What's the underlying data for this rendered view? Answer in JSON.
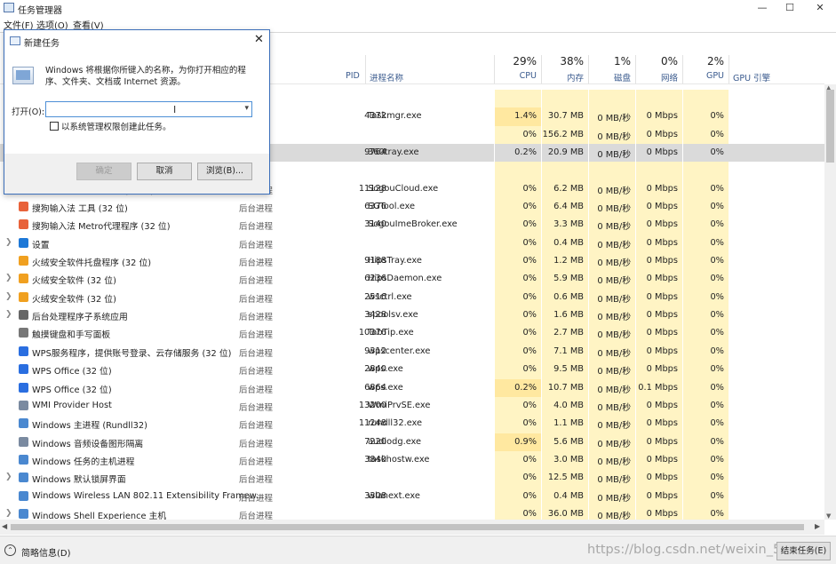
{
  "window": {
    "title": "任务管理器",
    "minimize": "—",
    "maximize": "☐",
    "close": "✕"
  },
  "menu": [
    "文件(F)",
    "选项(O)",
    "查看(V)"
  ],
  "columns": {
    "pid": "PID",
    "process_name": "进程名称",
    "cpu": {
      "pct": "29%",
      "label": "CPU"
    },
    "memory": {
      "pct": "38%",
      "label": "内存"
    },
    "disk": {
      "pct": "1%",
      "label": "磁盘"
    },
    "network": {
      "pct": "0%",
      "label": "网络"
    },
    "gpu": {
      "pct": "2%",
      "label": "GPU"
    },
    "gpu_engine": "GPU 引擎"
  },
  "rows": [
    {
      "name": "",
      "status": "",
      "pid": "",
      "proc": "",
      "cpu": "",
      "mem": "",
      "disk": "",
      "net": "",
      "gpu": ""
    },
    {
      "name": "",
      "status": "",
      "pid": "4372",
      "proc": "Taskmgr.exe",
      "cpu": "1.4%",
      "mem": "30.7 MB",
      "disk": "0 MB/秒",
      "net": "0 Mbps",
      "gpu": "0%"
    },
    {
      "name": "",
      "status": "",
      "pid": "",
      "proc": "",
      "cpu": "0%",
      "mem": "156.2 MB",
      "disk": "0 MB/秒",
      "net": "0 Mbps",
      "gpu": "0%"
    },
    {
      "name": "",
      "status": "",
      "pid": "9764",
      "proc": "360tray.exe",
      "cpu": "0.2%",
      "mem": "20.9 MB",
      "disk": "0 MB/秒",
      "net": "0 Mbps",
      "gpu": "0%",
      "selected": true
    },
    {
      "name": "",
      "status": "",
      "pid": "",
      "proc": "",
      "cpu": "",
      "mem": "",
      "disk": "",
      "net": "",
      "gpu": ""
    },
    {
      "name": "搜狗输入法 云计算代理 (32 位)",
      "status": "后台进程",
      "pid": "11128",
      "proc": "SogouCloud.exe",
      "cpu": "0%",
      "mem": "6.2 MB",
      "disk": "0 MB/秒",
      "net": "0 Mbps",
      "gpu": "0%",
      "icon": "sogou-icon"
    },
    {
      "name": "搜狗输入法 工具 (32 位)",
      "status": "后台进程",
      "pid": "6376",
      "proc": "SGTool.exe",
      "cpu": "0%",
      "mem": "6.4 MB",
      "disk": "0 MB/秒",
      "net": "0 Mbps",
      "gpu": "0%",
      "icon": "sogou-icon"
    },
    {
      "name": "搜狗输入法 Metro代理程序 (32 位)",
      "status": "后台进程",
      "pid": "3140",
      "proc": "SogouImeBroker.exe",
      "cpu": "0%",
      "mem": "3.3 MB",
      "disk": "0 MB/秒",
      "net": "0 Mbps",
      "gpu": "0%",
      "icon": "sogou-icon"
    },
    {
      "name": "设置",
      "status": "后台进程",
      "pid": "",
      "proc": "",
      "cpu": "0%",
      "mem": "0.4 MB",
      "disk": "0 MB/秒",
      "net": "0 Mbps",
      "gpu": "0%",
      "icon": "settings-icon",
      "expand": true
    },
    {
      "name": "火绒安全软件托盘程序 (32 位)",
      "status": "后台进程",
      "pid": "9188",
      "proc": "HipsTray.exe",
      "cpu": "0%",
      "mem": "1.2 MB",
      "disk": "0 MB/秒",
      "net": "0 Mbps",
      "gpu": "0%",
      "icon": "huorong-icon"
    },
    {
      "name": "火绒安全软件 (32 位)",
      "status": "后台进程",
      "pid": "6236",
      "proc": "HipsDaemon.exe",
      "cpu": "0%",
      "mem": "5.9 MB",
      "disk": "0 MB/秒",
      "net": "0 Mbps",
      "gpu": "0%",
      "icon": "huorong-icon",
      "expand": true
    },
    {
      "name": "火绒安全软件 (32 位)",
      "status": "后台进程",
      "pid": "2516",
      "proc": "wsctrl.exe",
      "cpu": "0%",
      "mem": "0.6 MB",
      "disk": "0 MB/秒",
      "net": "0 Mbps",
      "gpu": "0%",
      "icon": "huorong-icon",
      "expand": true
    },
    {
      "name": "后台处理程序子系统应用",
      "status": "后台进程",
      "pid": "3428",
      "proc": "spoolsv.exe",
      "cpu": "0%",
      "mem": "1.6 MB",
      "disk": "0 MB/秒",
      "net": "0 Mbps",
      "gpu": "0%",
      "icon": "printer-icon",
      "expand": true
    },
    {
      "name": "触摸键盘和手写面板",
      "status": "后台进程",
      "pid": "10376",
      "proc": "TabTip.exe",
      "cpu": "0%",
      "mem": "2.7 MB",
      "disk": "0 MB/秒",
      "net": "0 Mbps",
      "gpu": "0%",
      "icon": "keyboard-icon"
    },
    {
      "name": "WPS服务程序，提供账号登录、云存储服务 (32 位)",
      "status": "后台进程",
      "pid": "9312",
      "proc": "wpscenter.exe",
      "cpu": "0%",
      "mem": "7.1 MB",
      "disk": "0 MB/秒",
      "net": "0 Mbps",
      "gpu": "0%",
      "icon": "wps-icon"
    },
    {
      "name": "WPS Office (32 位)",
      "status": "后台进程",
      "pid": "2840",
      "proc": "wps.exe",
      "cpu": "0%",
      "mem": "9.5 MB",
      "disk": "0 MB/秒",
      "net": "0 Mbps",
      "gpu": "0%",
      "icon": "wps-icon"
    },
    {
      "name": "WPS Office (32 位)",
      "status": "后台进程",
      "pid": "6864",
      "proc": "wps.exe",
      "cpu": "0.2%",
      "mem": "10.7 MB",
      "disk": "0 MB/秒",
      "net": "0.1 Mbps",
      "gpu": "0%",
      "icon": "wps-icon"
    },
    {
      "name": "WMI Provider Host",
      "status": "后台进程",
      "pid": "13200",
      "proc": "WmiPrvSE.exe",
      "cpu": "0%",
      "mem": "4.0 MB",
      "disk": "0 MB/秒",
      "net": "0 Mbps",
      "gpu": "0%",
      "icon": "service-icon"
    },
    {
      "name": "Windows 主进程 (Rundll32)",
      "status": "后台进程",
      "pid": "11248",
      "proc": "rundll32.exe",
      "cpu": "0%",
      "mem": "1.1 MB",
      "disk": "0 MB/秒",
      "net": "0 Mbps",
      "gpu": "0%",
      "icon": "window-icon"
    },
    {
      "name": "Windows 音频设备图形隔离",
      "status": "后台进程",
      "pid": "7220",
      "proc": "audiodg.exe",
      "cpu": "0.9%",
      "mem": "5.6 MB",
      "disk": "0 MB/秒",
      "net": "0 Mbps",
      "gpu": "0%",
      "icon": "service-icon"
    },
    {
      "name": "Windows 任务的主机进程",
      "status": "后台进程",
      "pid": "3840",
      "proc": "taskhostw.exe",
      "cpu": "0%",
      "mem": "3.0 MB",
      "disk": "0 MB/秒",
      "net": "0 Mbps",
      "gpu": "0%",
      "icon": "window-icon"
    },
    {
      "name": "Windows 默认锁屏界面",
      "status": "后台进程",
      "pid": "",
      "proc": "",
      "cpu": "0%",
      "mem": "12.5 MB",
      "disk": "0 MB/秒",
      "net": "0 Mbps",
      "gpu": "0%",
      "icon": "window-icon",
      "expand": true
    },
    {
      "name": "Windows Wireless LAN 802.11 Extensibility Framew...",
      "status": "后台进程",
      "pid": "3308",
      "proc": "wlanext.exe",
      "cpu": "0%",
      "mem": "0.4 MB",
      "disk": "0 MB/秒",
      "net": "0 Mbps",
      "gpu": "0%",
      "icon": "window-icon"
    },
    {
      "name": "Windows Shell Experience 主机",
      "status": "后台进程",
      "pid": "",
      "proc": "",
      "cpu": "0%",
      "mem": "36.0 MB",
      "disk": "0 MB/秒",
      "net": "0 Mbps",
      "gpu": "0%",
      "icon": "window-icon",
      "expand": true
    }
  ],
  "footer": {
    "less_details": "简略信息(D)",
    "end_task": "结束任务(E)",
    "watermark": "https://blog.csdn.net/weixin_5"
  },
  "dialog": {
    "title": "新建任务",
    "description": "Windows 将根据你所键入的名称，为你打开相应的程序、文件夹、文档或 Internet 资源。",
    "open_label": "打开(O):",
    "open_value": "",
    "admin_checkbox_label": "以系统管理权限创建此任务。",
    "ok": "确定",
    "cancel": "取消",
    "browse": "浏览(B)..."
  },
  "colors": {
    "cpu_heat": "#fff4c4",
    "cpu_heat_strong": "#ffe8a0",
    "selected_row": "#dadada",
    "header_label": "#3b5b8e"
  }
}
